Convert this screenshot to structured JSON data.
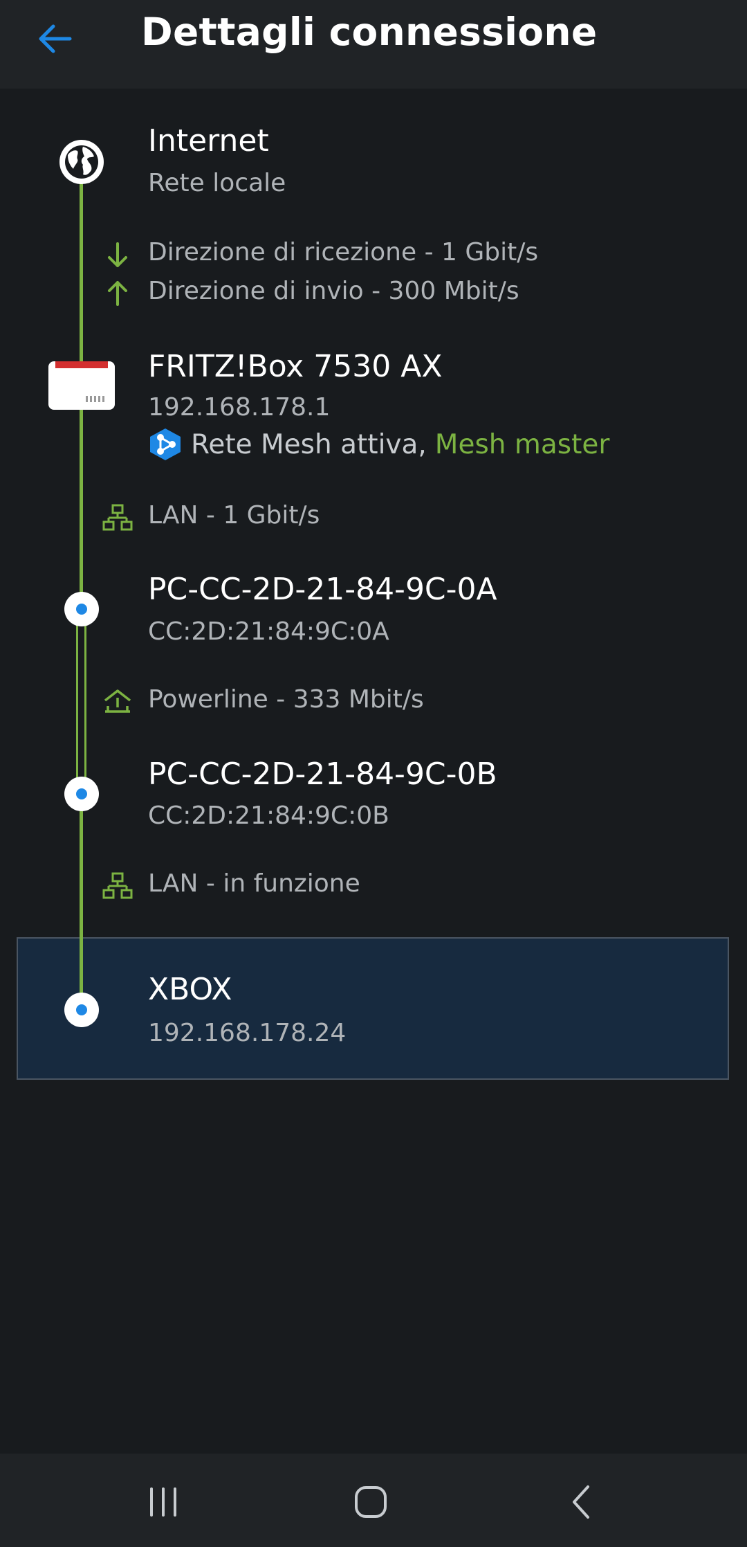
{
  "header": {
    "title": "Dettagli connessione",
    "back_icon": "arrow-left-icon"
  },
  "colors": {
    "accent_green": "#7cb342",
    "accent_blue": "#1e88e5",
    "background": "#181b1e",
    "bar": "#202326",
    "selected_row": "#172a3f"
  },
  "nodes": {
    "internet": {
      "name": "Internet",
      "subtitle": "Rete locale",
      "icon": "globe-icon"
    },
    "fritzbox": {
      "name": "FRITZ!Box 7530 AX",
      "ip": "192.168.178.1",
      "mesh_text": "Rete Mesh attiva,",
      "mesh_role": "Mesh master",
      "icon": "router-icon",
      "mesh_icon": "mesh-icon"
    },
    "pc_a": {
      "name": "PC-CC-2D-21-84-9C-0A",
      "mac": "CC:2D:21:84:9C:0A"
    },
    "pc_b": {
      "name": "PC-CC-2D-21-84-9C-0B",
      "mac": "CC:2D:21:84:9C:0B"
    },
    "xbox": {
      "name": "XBOX",
      "ip": "192.168.178.24"
    }
  },
  "links": {
    "download": "Direzione di ricezione - 1 Gbit/s",
    "upload": "Direzione di invio - 300 Mbit/s",
    "lan_1": "LAN - 1 Gbit/s",
    "powerline": "Powerline - 333 Mbit/s",
    "lan_2": "LAN - in funzione"
  },
  "navbar": {
    "recents_icon": "recent-apps-icon",
    "home_icon": "home-icon",
    "back_icon": "nav-back-icon"
  }
}
